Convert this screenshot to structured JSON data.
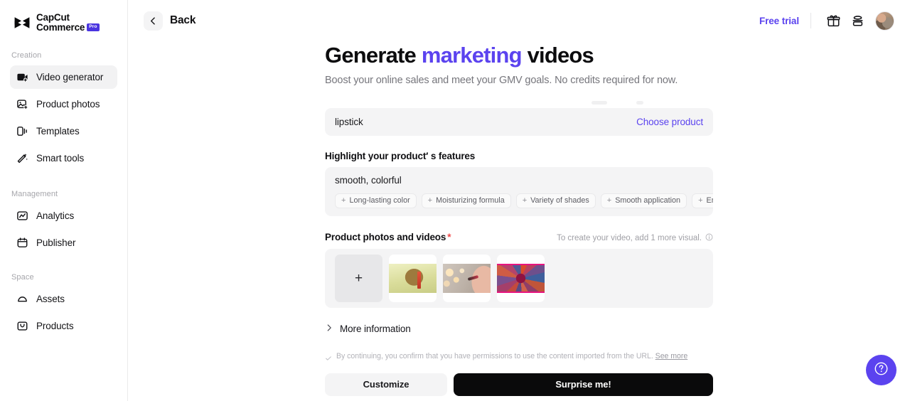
{
  "sidebar": {
    "logo": {
      "line1": "CapCut",
      "line2": "Commerce",
      "badge": "Pro",
      "icon": "capcut-logo-icon"
    },
    "groups": [
      {
        "label": "Creation",
        "items": [
          {
            "label": "Video generator",
            "icon": "video-generator-icon",
            "active": true
          },
          {
            "label": "Product photos",
            "icon": "product-photos-icon",
            "active": false
          },
          {
            "label": "Templates",
            "icon": "templates-icon",
            "active": false
          },
          {
            "label": "Smart tools",
            "icon": "smart-tools-icon",
            "active": false
          }
        ]
      },
      {
        "label": "Management",
        "items": [
          {
            "label": "Analytics",
            "icon": "analytics-icon",
            "active": false
          },
          {
            "label": "Publisher",
            "icon": "publisher-icon",
            "active": false
          }
        ]
      },
      {
        "label": "Space",
        "items": [
          {
            "label": "Assets",
            "icon": "assets-cloud-icon",
            "active": false
          },
          {
            "label": "Products",
            "icon": "products-bag-icon",
            "active": false
          }
        ]
      }
    ]
  },
  "topbar": {
    "back_label": "Back",
    "back_icon": "chevron-left-icon",
    "free_trial_label": "Free trial",
    "gift_icon": "gift-icon",
    "credits_icon": "credits-coin-icon",
    "avatar": "user-avatar"
  },
  "main": {
    "title_part1": "Generate ",
    "title_accent": "marketing",
    "title_part2": " videos",
    "subtitle": "Boost your online sales and meet your GMV goals. No credits required for now.",
    "product": {
      "value": "lipstick",
      "choose_label": "Choose product"
    },
    "features": {
      "label": "Highlight your product′ s features",
      "value": "smooth, colorful",
      "chips": [
        "Long-lasting color",
        "Moisturizing formula",
        "Variety of shades",
        "Smooth application",
        "Enh"
      ]
    },
    "media": {
      "label": "Product photos and videos",
      "required_mark": "*",
      "hint": "To create your video, add 1 more visual.",
      "hint_icon": "info-icon",
      "add_tile_icon": "plus-icon",
      "thumbnails": [
        {
          "name": "lipstick-with-mirror-thumbnail"
        },
        {
          "name": "woman-applying-lipstick-thumbnail"
        },
        {
          "name": "lipstick-fan-arrangement-thumbnail"
        }
      ]
    },
    "more_information": {
      "label": "More information",
      "icon": "chevron-right-icon"
    },
    "consent": {
      "checkbox_icon": "check-icon",
      "text": "By continuing, you confirm that you have permissions to use the content imported from the URL.",
      "see_more": "See more"
    },
    "actions": {
      "customize": "Customize",
      "surprise": "Surprise me!"
    },
    "help_icon": "question-mark-icon"
  },
  "colors": {
    "accent_purple": "#5b43ef",
    "badge_purple": "#4a35e0",
    "required_red": "#f04b4b",
    "primary_button": "#0a0a0b",
    "panel_gray": "#f4f4f5"
  }
}
